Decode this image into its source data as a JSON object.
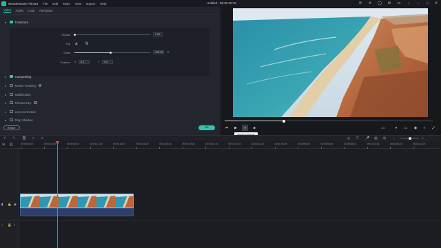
{
  "app_name": "Wondershare Filmora",
  "menu": [
    "File",
    "Edit",
    "Tools",
    "View",
    "Export",
    "Help"
  ],
  "document_title": "Untitled : 00:00:20:19",
  "tabs": [
    {
      "label": "Video",
      "active": true
    },
    {
      "label": "Audio",
      "active": false
    },
    {
      "label": "Color",
      "active": false
    },
    {
      "label": "Animation",
      "active": false
    }
  ],
  "transform": {
    "label": "Transform",
    "rotate_label": "Rotate",
    "rotate_value": "0.00",
    "flip_label": "Flip",
    "scale_label": "Scale",
    "scale_value": "100.00",
    "scale_unit": "%",
    "scale_level": 0.48,
    "position_label": "Position",
    "x_label": "X",
    "x_value": "0.0",
    "y_label": "Y",
    "y_value": "0.0"
  },
  "sections": [
    {
      "label": "Compositing",
      "checked": true,
      "info": false
    },
    {
      "label": "Motion Tracking",
      "checked": false,
      "info": true
    },
    {
      "label": "Stabilization",
      "checked": false,
      "info": false
    },
    {
      "label": "Chroma Key",
      "checked": false,
      "info": true
    },
    {
      "label": "Lens Correction",
      "checked": false,
      "info": false
    },
    {
      "label": "Drop Shadow",
      "checked": false,
      "info": false
    }
  ],
  "buttons": {
    "reset": "RESET",
    "ok": "OK"
  },
  "player": {
    "progress": 0.285,
    "tooltip": "Pause (Space)",
    "quality": "1/2"
  },
  "ruler_labels": [
    "00:00:00:00",
    "00:00:04:05",
    "00:00:08:10",
    "00:00:12:15",
    "00:00:16:20",
    "00:00:20:25",
    "00:00:25:00",
    "00:00:29:05",
    "00:00:33:10",
    "00:00:37:15",
    "00:00:41:20",
    "00:00:45:25",
    "00:00:50:00",
    "00:00:54:05",
    "00:00:58:10",
    "00:01:02:15",
    "00:01:06:20",
    "00:01:10:25"
  ],
  "colors": {
    "accent": "#2fc3b0",
    "playhead": "#e0564a",
    "clip_border": "#6ab7d8"
  }
}
